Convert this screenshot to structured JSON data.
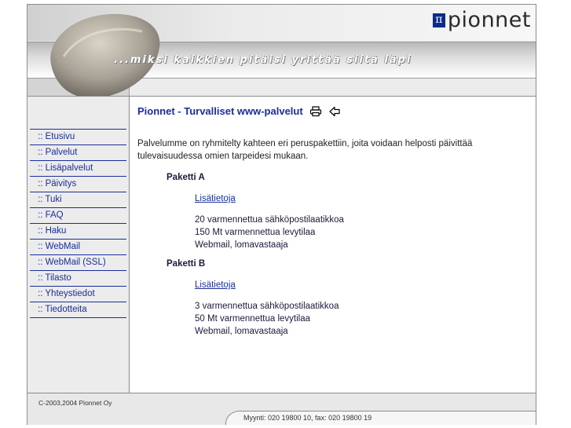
{
  "brand": {
    "logo_text": "pionnet",
    "pi_glyph": "π",
    "slogan": "...miksi kaikkien pitäisi yrittää siitä läpi"
  },
  "page": {
    "title": "Pionnet - Turvalliset www-palvelut"
  },
  "icons": {
    "print": "printer-icon",
    "back": "back-arrow-icon"
  },
  "nav": {
    "items": [
      {
        "label": ":: Etusivu"
      },
      {
        "label": ":: Palvelut"
      },
      {
        "label": ":: Lisäpalvelut"
      },
      {
        "label": ":: Päivitys"
      },
      {
        "label": ":: Tuki"
      },
      {
        "label": ":: FAQ"
      },
      {
        "label": ":: Haku"
      },
      {
        "label": ":: WebMail"
      },
      {
        "label": ":: WebMail (SSL)"
      },
      {
        "label": ":: Tilasto"
      },
      {
        "label": ":: Yhteystiedot"
      },
      {
        "label": ":: Tiedotteita"
      }
    ]
  },
  "content": {
    "intro_line1": "Palvelumme on ryhmitelty kahteen eri peruspakettiin, joita voidaan helposti päivittää",
    "intro_line2": "tulevaisuudessa omien tarpeidesi mukaan.",
    "packages": [
      {
        "title": "Paketti A",
        "link": "Lisätietoja",
        "features": [
          "20 varmennettua sähköpostilaatikkoa",
          "150 Mt varmennettua levytilaa",
          "Webmail, lomavastaaja"
        ]
      },
      {
        "title": "Paketti B",
        "link": "Lisätietoja",
        "features": [
          "3 varmennettua sähköpostilaatikkoa",
          "50 Mt varmennettua levytilaa",
          "Webmail, lomavastaaja"
        ]
      }
    ]
  },
  "footer": {
    "copyright": "C-2003,2004 Pionnet Oy",
    "contact": "Myynti: 020 19800 10, fax: 020 19800 19"
  },
  "colors": {
    "link_blue": "#1a2e9a",
    "logo_blue": "#0b2c8a"
  }
}
